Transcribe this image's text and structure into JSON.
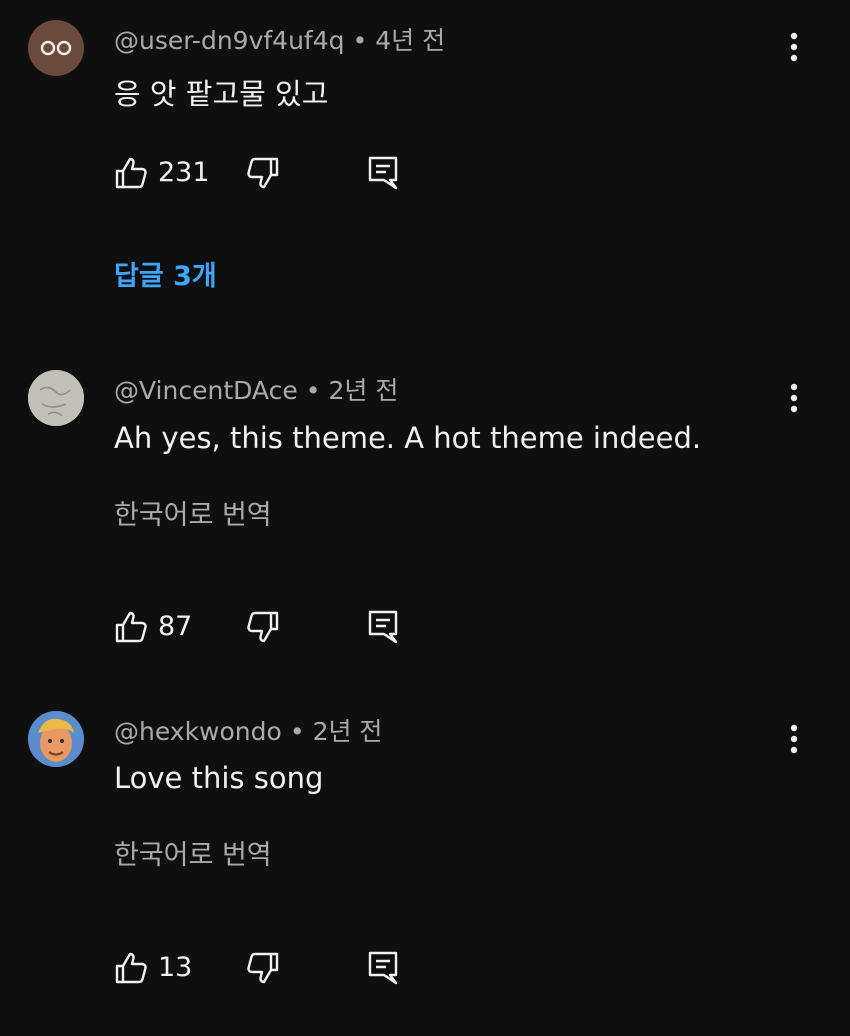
{
  "comments": [
    {
      "author": "@user-dn9vf4uf4q",
      "time": "4년 전",
      "text": "응 앗 팥고물 있고",
      "likes": "231",
      "replies_label": "답글 3개"
    },
    {
      "author": "@VincentDAce",
      "time": "2년 전",
      "text": "Ah yes, this theme. A hot theme indeed.",
      "translate_label": "한국어로 번역",
      "likes": "87"
    },
    {
      "author": "@hexkwondo",
      "time": "2년 전",
      "text": "Love this song",
      "translate_label": "한국어로 번역",
      "likes": "13"
    }
  ],
  "separator": "•",
  "colors": {
    "background": "#0f0f0f",
    "text": "#f1f1f1",
    "secondary": "#aaaaaa",
    "link": "#3ea6ff"
  },
  "icons": [
    "like-icon",
    "dislike-icon",
    "reply-icon",
    "more-vert-icon"
  ]
}
